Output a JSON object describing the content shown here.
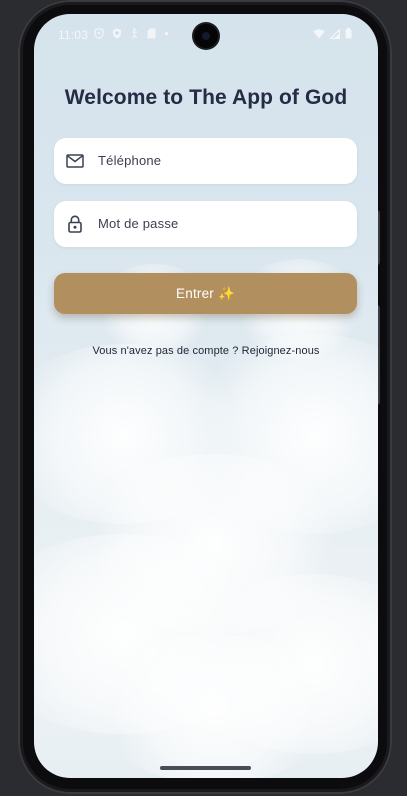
{
  "status_bar": {
    "time": "11:03",
    "left_icons": [
      "shield-icon",
      "shield-check-icon",
      "accessibility-icon",
      "sd-card-icon",
      "dot-icon"
    ],
    "right_icons": [
      "wifi-icon",
      "signal-icon",
      "battery-icon"
    ]
  },
  "login": {
    "title": "Welcome to The App of God",
    "phone_field": {
      "placeholder": "Téléphone",
      "icon": "mail-icon"
    },
    "password_field": {
      "placeholder": "Mot de passe",
      "icon": "lock-icon"
    },
    "enter_button": {
      "label": "Entrer ✨"
    },
    "signup_link": "Vous n'avez pas de compte ? Rejoignez-nous"
  },
  "colors": {
    "title": "#252c45",
    "button": "#b28f5f",
    "field_background": "#ffffff",
    "sky": "#d5e3ec"
  }
}
